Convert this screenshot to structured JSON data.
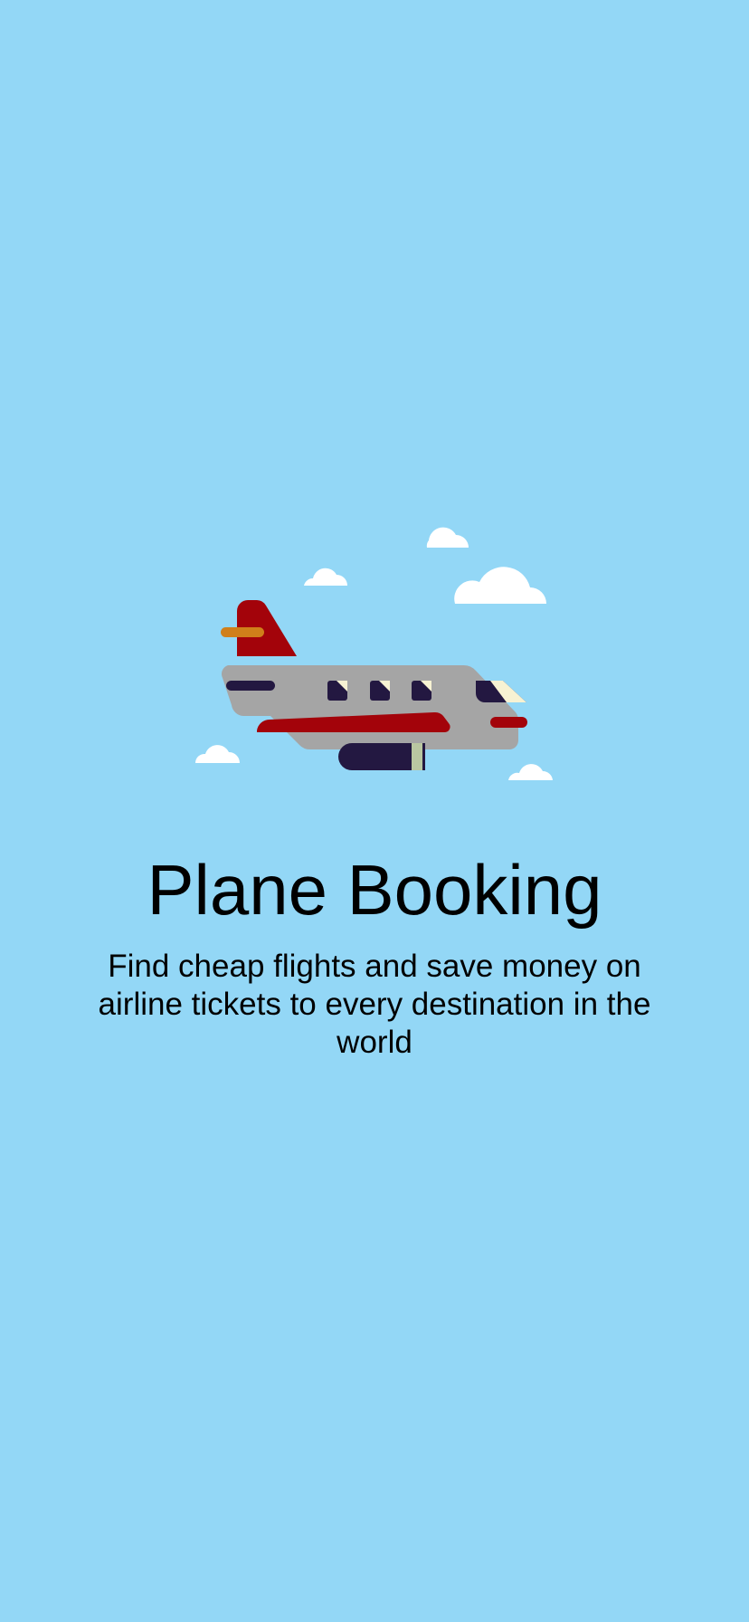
{
  "app": {
    "title": "Plane Booking",
    "subtitle": "Find cheap flights and save money on airline tickets to every destination in the world"
  },
  "hero": {
    "icon": "airplane-with-clouds-illustration"
  },
  "colors": {
    "background": "#93d7f6",
    "fuselage": "#a5a5a5",
    "accent_red": "#a3030a",
    "window_dark": "#231841",
    "window_light": "#f7f2d3",
    "tail_stripe": "#d07f1a",
    "cloud": "#ffffff"
  }
}
